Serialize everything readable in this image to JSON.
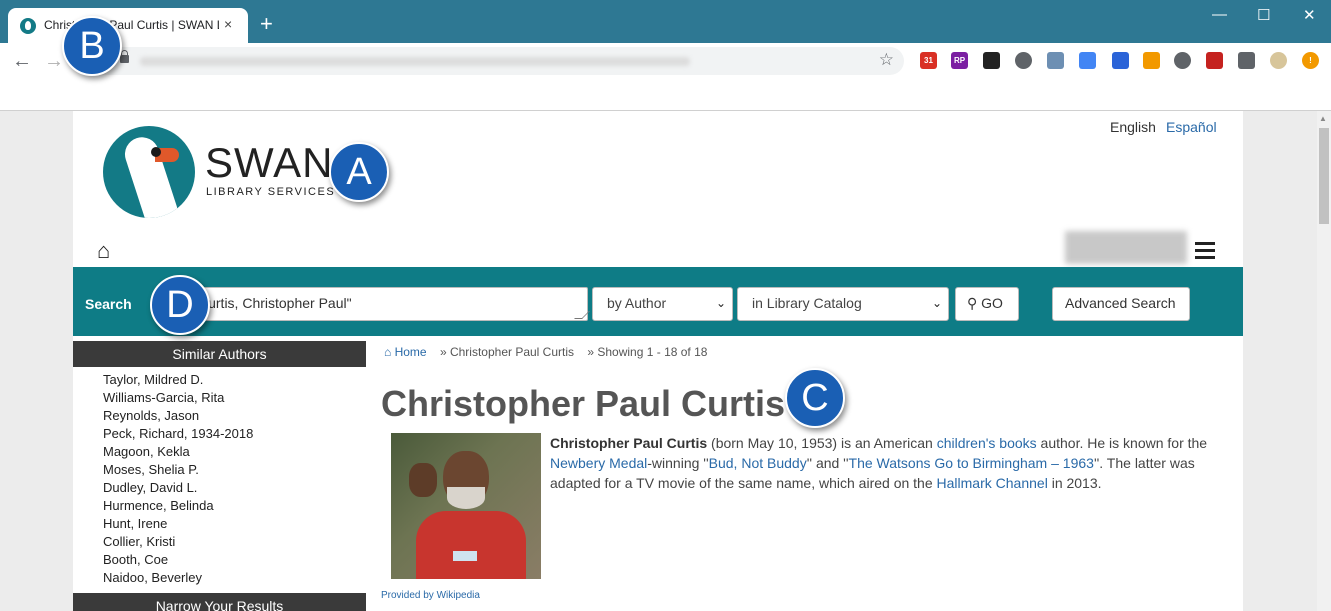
{
  "browser": {
    "tab_title": "Christopher Paul Curtis | SWAN Library Services",
    "tab_close": "×",
    "new_tab": "+",
    "window_controls": [
      "—",
      "☐",
      "✕"
    ],
    "back_icon": "←",
    "forward_icon": "→",
    "star_icon": "☆",
    "extensions": [
      {
        "name": "calendar-extension-icon",
        "color": "#d93025",
        "label": "31"
      },
      {
        "name": "rp-extension-icon",
        "color": "#7b1fa2",
        "label": "RP"
      },
      {
        "name": "grid-extension-icon",
        "color": "#222222",
        "label": ""
      },
      {
        "name": "wordpress-extension-icon",
        "color": "#5f6368",
        "label": ""
      },
      {
        "name": "books-extension-icon",
        "color": "#6d8fb3",
        "label": ""
      },
      {
        "name": "reader-extension-icon",
        "color": "#4285f4",
        "label": ""
      },
      {
        "name": "eyedropper-extension-icon",
        "color": "#2b64d8",
        "label": ""
      },
      {
        "name": "carrot-extension-icon",
        "color": "#f29900",
        "label": ""
      },
      {
        "name": "circle-extension-icon",
        "color": "#5f6368",
        "label": ""
      },
      {
        "name": "pdf-extension-icon",
        "color": "#c5221f",
        "label": ""
      },
      {
        "name": "puzzle-extension-icon",
        "color": "#5f6368",
        "label": ""
      },
      {
        "name": "profile-extension-icon",
        "color": "#d7c59a",
        "label": ""
      },
      {
        "name": "alert-extension-icon",
        "color": "#f29900",
        "label": "!"
      }
    ]
  },
  "header": {
    "lang_english": "English",
    "lang_spanish": "Español",
    "logo_title": "SWAN",
    "logo_subtitle": "LIBRARY SERVICES",
    "home_icon": "⌂"
  },
  "search": {
    "label": "Search",
    "query": "Curtis, Christopher Paul\"",
    "by_select": "by Author",
    "scope_select": "in Library Catalog",
    "go_label": "GO",
    "go_icon": "⚲",
    "advanced_label": "Advanced Search"
  },
  "sidebar": {
    "similar_heading": "Similar Authors",
    "authors": [
      "Taylor, Mildred D.",
      "Williams-Garcia, Rita",
      "Reynolds, Jason",
      "Peck, Richard, 1934-2018",
      "Magoon, Kekla",
      "Moses, Shelia P.",
      "Dudley, David L.",
      "Hurmence, Belinda",
      "Hunt, Irene",
      "Collier, Kristi",
      "Booth, Coe",
      "Naidoo, Beverley"
    ],
    "narrow_heading": "Narrow Your Results"
  },
  "main": {
    "breadcrumb_home": "Home",
    "breadcrumb_author": "» Christopher Paul Curtis",
    "breadcrumb_showing": "» Showing 1 - 18 of 18",
    "author_name": "Christopher Paul Curtis",
    "bio": {
      "name": "Christopher Paul Curtis",
      "t1": " (born May 10, 1953) is an American ",
      "link_childrens": "children's books",
      "t2": " author. He is known for the ",
      "link_newbery": "Newbery Medal",
      "t3": "-winning ''",
      "link_bud": "Bud, Not Buddy",
      "t4": "'' and ''",
      "link_watsons": "The Watsons Go to Birmingham – 1963",
      "t5": "''. The latter was adapted for a TV movie of the same name, which aired on the ",
      "link_hallmark": "Hallmark Channel",
      "t6": " in 2013."
    },
    "wiki_credit": "Provided by Wikipedia"
  },
  "markers": {
    "a": "A",
    "b": "B",
    "c": "C",
    "d": "D"
  },
  "colors": {
    "teal_bar": "#0e7c86",
    "browser_frame": "#2e7893",
    "link": "#2a6aa8",
    "marker": "#1a5fb4",
    "sidebar_heading": "#3a3a3a"
  }
}
